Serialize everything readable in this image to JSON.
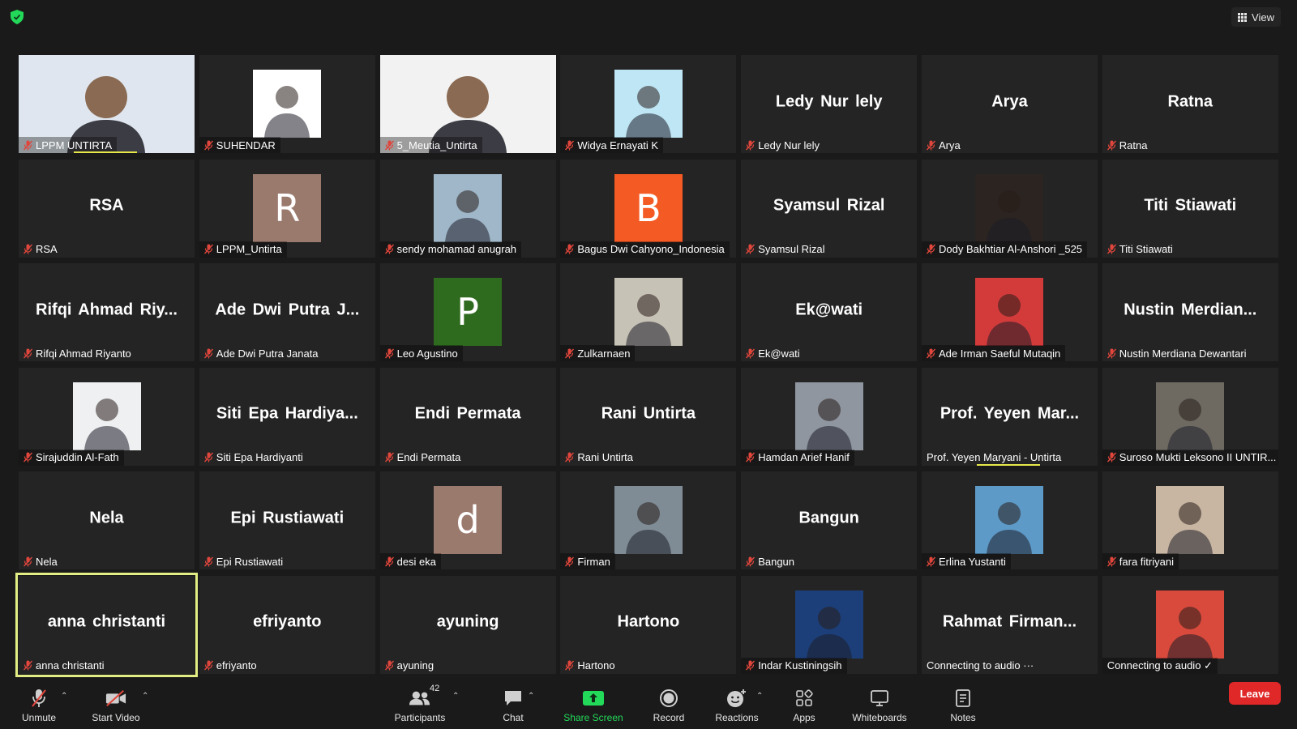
{
  "topbar": {
    "view_label": "View"
  },
  "accent": {
    "active_speaker": "#e2ee84",
    "share": "#23d959",
    "leave": "#e02828",
    "muted": "#e0463c"
  },
  "tiles": [
    {
      "label": "LPPM UNTIRTA",
      "display": "",
      "kind": "video",
      "bg": "#dfe6ef"
    },
    {
      "label": "SUHENDAR",
      "display": "",
      "kind": "image",
      "bg": "#ffffff"
    },
    {
      "label": "5_Meutia_Untirta",
      "display": "",
      "kind": "video",
      "bg": "#f2f2f2"
    },
    {
      "label": "Widya Ernayati K",
      "display": "",
      "kind": "image",
      "bg": "#bfe6f5"
    },
    {
      "label": "Ledy Nur lely",
      "display": "Ledy Nur lely",
      "kind": "name"
    },
    {
      "label": "Arya",
      "display": "Arya",
      "kind": "name"
    },
    {
      "label": "Ratna",
      "display": "Ratna",
      "kind": "name"
    },
    {
      "label": "RSA",
      "display": "RSA",
      "kind": "name"
    },
    {
      "label": "LPPM_Untirta",
      "display": "",
      "kind": "letter",
      "letter": "R",
      "bg": "#9b7a6e"
    },
    {
      "label": "sendy mohamad anugrah",
      "display": "",
      "kind": "image",
      "bg": "#9fb7c9"
    },
    {
      "label": "Bagus Dwi Cahyono_Indonesia",
      "display": "",
      "kind": "letter",
      "letter": "B",
      "bg": "#f45a24"
    },
    {
      "label": "Syamsul Rizal",
      "display": "Syamsul Rizal",
      "kind": "name"
    },
    {
      "label": "Dody Bakhtiar Al-Anshori _525",
      "display": "",
      "kind": "image",
      "bg": "#2b2420"
    },
    {
      "label": "Titi Stiawati",
      "display": "Titi Stiawati",
      "kind": "name"
    },
    {
      "label": "Rifqi Ahmad Riyanto",
      "display": "Rifqi Ahmad Riy...",
      "kind": "name"
    },
    {
      "label": "Ade Dwi Putra Janata",
      "display": "Ade Dwi Putra J...",
      "kind": "name"
    },
    {
      "label": "Leo Agustino",
      "display": "",
      "kind": "letter",
      "letter": "P",
      "bg": "#2f6b1f"
    },
    {
      "label": "Zulkarnaen",
      "display": "",
      "kind": "image",
      "bg": "#c7c2b6"
    },
    {
      "label": "Ek@wati",
      "display": "Ek@wati",
      "kind": "name"
    },
    {
      "label": "Ade Irman Saeful Mutaqin",
      "display": "",
      "kind": "image",
      "bg": "#d33b3b"
    },
    {
      "label": "Nustin Merdiana Dewantari",
      "display": "Nustin Merdian...",
      "kind": "name"
    },
    {
      "label": "Sirajuddin Al-Fath",
      "display": "",
      "kind": "image",
      "bg": "#eef0f2"
    },
    {
      "label": "Siti Epa Hardiyanti",
      "display": "Siti Epa Hardiya...",
      "kind": "name"
    },
    {
      "label": "Endi Permata",
      "display": "Endi Permata",
      "kind": "name"
    },
    {
      "label": "Rani Untirta",
      "display": "Rani Untirta",
      "kind": "name"
    },
    {
      "label": "Hamdan Arief Hanif",
      "display": "",
      "kind": "image",
      "bg": "#8f96a0"
    },
    {
      "label": "Prof. Yeyen Maryani - Untirta",
      "display": "Prof. Yeyen Mar...",
      "kind": "name",
      "unmuted": true
    },
    {
      "label": "Suroso Mukti Leksono II UNTIR...",
      "display": "",
      "kind": "image",
      "bg": "#6e6a62"
    },
    {
      "label": "Nela",
      "display": "Nela",
      "kind": "name"
    },
    {
      "label": "Epi Rustiawati",
      "display": "Epi Rustiawati",
      "kind": "name"
    },
    {
      "label": "desi eka",
      "display": "",
      "kind": "letter",
      "letter": "d",
      "bg": "#9b7a6e"
    },
    {
      "label": "Firman",
      "display": "",
      "kind": "image",
      "bg": "#7f8c96"
    },
    {
      "label": "Bangun",
      "display": "Bangun",
      "kind": "name"
    },
    {
      "label": "Erlina Yustanti",
      "display": "",
      "kind": "image",
      "bg": "#5d9ac8"
    },
    {
      "label": "fara fitriyani",
      "display": "",
      "kind": "image",
      "bg": "#c8b6a2"
    },
    {
      "label": "anna christanti",
      "display": "anna christanti",
      "kind": "name",
      "active": true
    },
    {
      "label": "efriyanto",
      "display": "efriyanto",
      "kind": "name"
    },
    {
      "label": "ayuning",
      "display": "ayuning",
      "kind": "name"
    },
    {
      "label": "Hartono",
      "display": "Hartono",
      "kind": "name"
    },
    {
      "label": "Indar Kustiningsih",
      "display": "",
      "kind": "image",
      "bg": "#1c3f7a"
    },
    {
      "label": "Connecting to audio ···",
      "display": "Rahmat Firman...",
      "kind": "name",
      "unmuted": true
    },
    {
      "label": "Connecting to audio ✓",
      "display": "",
      "kind": "image",
      "bg": "#d94a3c",
      "unmuted": true
    }
  ],
  "toolbar": {
    "unmute": "Unmute",
    "start_video": "Start Video",
    "participants": "Participants",
    "participant_count": "42",
    "chat": "Chat",
    "share_screen": "Share Screen",
    "record": "Record",
    "reactions": "Reactions",
    "apps": "Apps",
    "whiteboards": "Whiteboards",
    "notes": "Notes",
    "leave": "Leave"
  }
}
